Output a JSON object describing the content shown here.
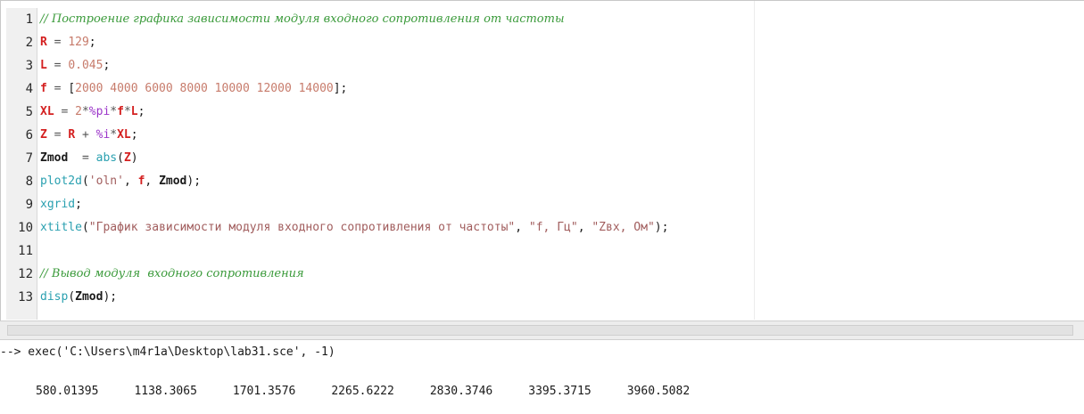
{
  "editor": {
    "lines": [
      {
        "num": "1",
        "parts": [
          {
            "t": "// Построение графика зависимости модуля входного сопротивления от частоты",
            "c": "cmt"
          }
        ]
      },
      {
        "num": "2",
        "parts": [
          {
            "t": "R",
            "c": "var"
          },
          {
            "t": " = ",
            "c": "op"
          },
          {
            "t": "129",
            "c": "num"
          },
          {
            "t": ";",
            "c": "kw"
          }
        ]
      },
      {
        "num": "3",
        "parts": [
          {
            "t": "L",
            "c": "var"
          },
          {
            "t": " = ",
            "c": "op"
          },
          {
            "t": "0.045",
            "c": "num"
          },
          {
            "t": ";",
            "c": "kw"
          }
        ]
      },
      {
        "num": "4",
        "parts": [
          {
            "t": "f",
            "c": "var"
          },
          {
            "t": " = ",
            "c": "op"
          },
          {
            "t": "[",
            "c": "kw"
          },
          {
            "t": "2000 4000 6000 8000 10000 12000 14000",
            "c": "num"
          },
          {
            "t": "];",
            "c": "kw"
          }
        ]
      },
      {
        "num": "5",
        "parts": [
          {
            "t": "XL",
            "c": "var"
          },
          {
            "t": " = ",
            "c": "op"
          },
          {
            "t": "2",
            "c": "num"
          },
          {
            "t": "*",
            "c": "op"
          },
          {
            "t": "%pi",
            "c": "cons"
          },
          {
            "t": "*",
            "c": "op"
          },
          {
            "t": "f",
            "c": "var"
          },
          {
            "t": "*",
            "c": "op"
          },
          {
            "t": "L",
            "c": "var"
          },
          {
            "t": ";",
            "c": "kw"
          }
        ]
      },
      {
        "num": "6",
        "parts": [
          {
            "t": "Z",
            "c": "var"
          },
          {
            "t": " = ",
            "c": "op"
          },
          {
            "t": "R",
            "c": "var"
          },
          {
            "t": " + ",
            "c": "op"
          },
          {
            "t": "%i",
            "c": "cons"
          },
          {
            "t": "*",
            "c": "op"
          },
          {
            "t": "XL",
            "c": "var"
          },
          {
            "t": ";",
            "c": "kw"
          }
        ]
      },
      {
        "num": "7",
        "parts": [
          {
            "t": "Zmod",
            "c": "kw"
          },
          {
            "t": "  = ",
            "c": "op"
          },
          {
            "t": "abs",
            "c": "fn"
          },
          {
            "t": "(",
            "c": "kw"
          },
          {
            "t": "Z",
            "c": "var"
          },
          {
            "t": ")",
            "c": "kw"
          }
        ]
      },
      {
        "num": "8",
        "parts": [
          {
            "t": "plot2d",
            "c": "fn"
          },
          {
            "t": "(",
            "c": "kw"
          },
          {
            "t": "'oln'",
            "c": "str"
          },
          {
            "t": ", ",
            "c": "kw"
          },
          {
            "t": "f",
            "c": "var"
          },
          {
            "t": ", ",
            "c": "kw"
          },
          {
            "t": "Zmod",
            "c": "kw"
          },
          {
            "t": ");",
            "c": "kw"
          }
        ]
      },
      {
        "num": "9",
        "parts": [
          {
            "t": "xgrid",
            "c": "fn"
          },
          {
            "t": ";",
            "c": "kw"
          }
        ]
      },
      {
        "num": "10",
        "parts": [
          {
            "t": "xtitle",
            "c": "fn"
          },
          {
            "t": "(",
            "c": "kw"
          },
          {
            "t": "\"График зависимости модуля входного сопротивления от частоты\"",
            "c": "str"
          },
          {
            "t": ", ",
            "c": "kw"
          },
          {
            "t": "\"f, Гц\"",
            "c": "str"
          },
          {
            "t": ", ",
            "c": "kw"
          },
          {
            "t": "\"Zвх, Ом\"",
            "c": "str"
          },
          {
            "t": ");",
            "c": "kw"
          }
        ]
      },
      {
        "num": "11",
        "parts": []
      },
      {
        "num": "12",
        "parts": [
          {
            "t": "// Вывод модуля  входного сопротивления",
            "c": "cmt"
          }
        ]
      },
      {
        "num": "13",
        "parts": [
          {
            "t": "disp",
            "c": "fn"
          },
          {
            "t": "(",
            "c": "kw"
          },
          {
            "t": "Zmod",
            "c": "kw"
          },
          {
            "t": ");",
            "c": "kw"
          }
        ]
      }
    ]
  },
  "console": {
    "command": "--> exec('C:\\Users\\m4r1a\\Desktop\\lab31.sce', -1)",
    "results": [
      "580.01395",
      "1138.3065",
      "1701.3576",
      "2265.6222",
      "2830.3746",
      "3395.3715",
      "3960.5082"
    ]
  }
}
